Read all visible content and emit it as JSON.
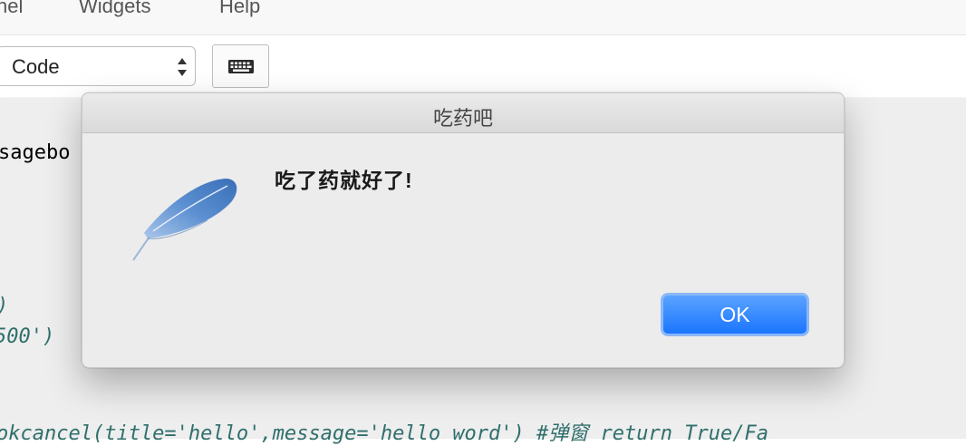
{
  "menubar": {
    "items": [
      {
        "label": "nel"
      },
      {
        "label": "Widgets"
      },
      {
        "label": "Help"
      }
    ]
  },
  "toolbar": {
    "cell_type_value": "Code",
    "keyboard_icon": "keyboard-icon"
  },
  "code": {
    "line1": "sagebo",
    "line2": ")",
    "line3": "500')",
    "line4": "okcancel(title='hello',message='hello word') #弹窗 return True/Fa"
  },
  "dialog": {
    "title": "吃药吧",
    "message": "吃了药就好了!",
    "icon": "feather-icon",
    "ok_label": "OK"
  },
  "colors": {
    "ok_button": "#1a75ff",
    "code_comment": "#2f6f6b"
  }
}
